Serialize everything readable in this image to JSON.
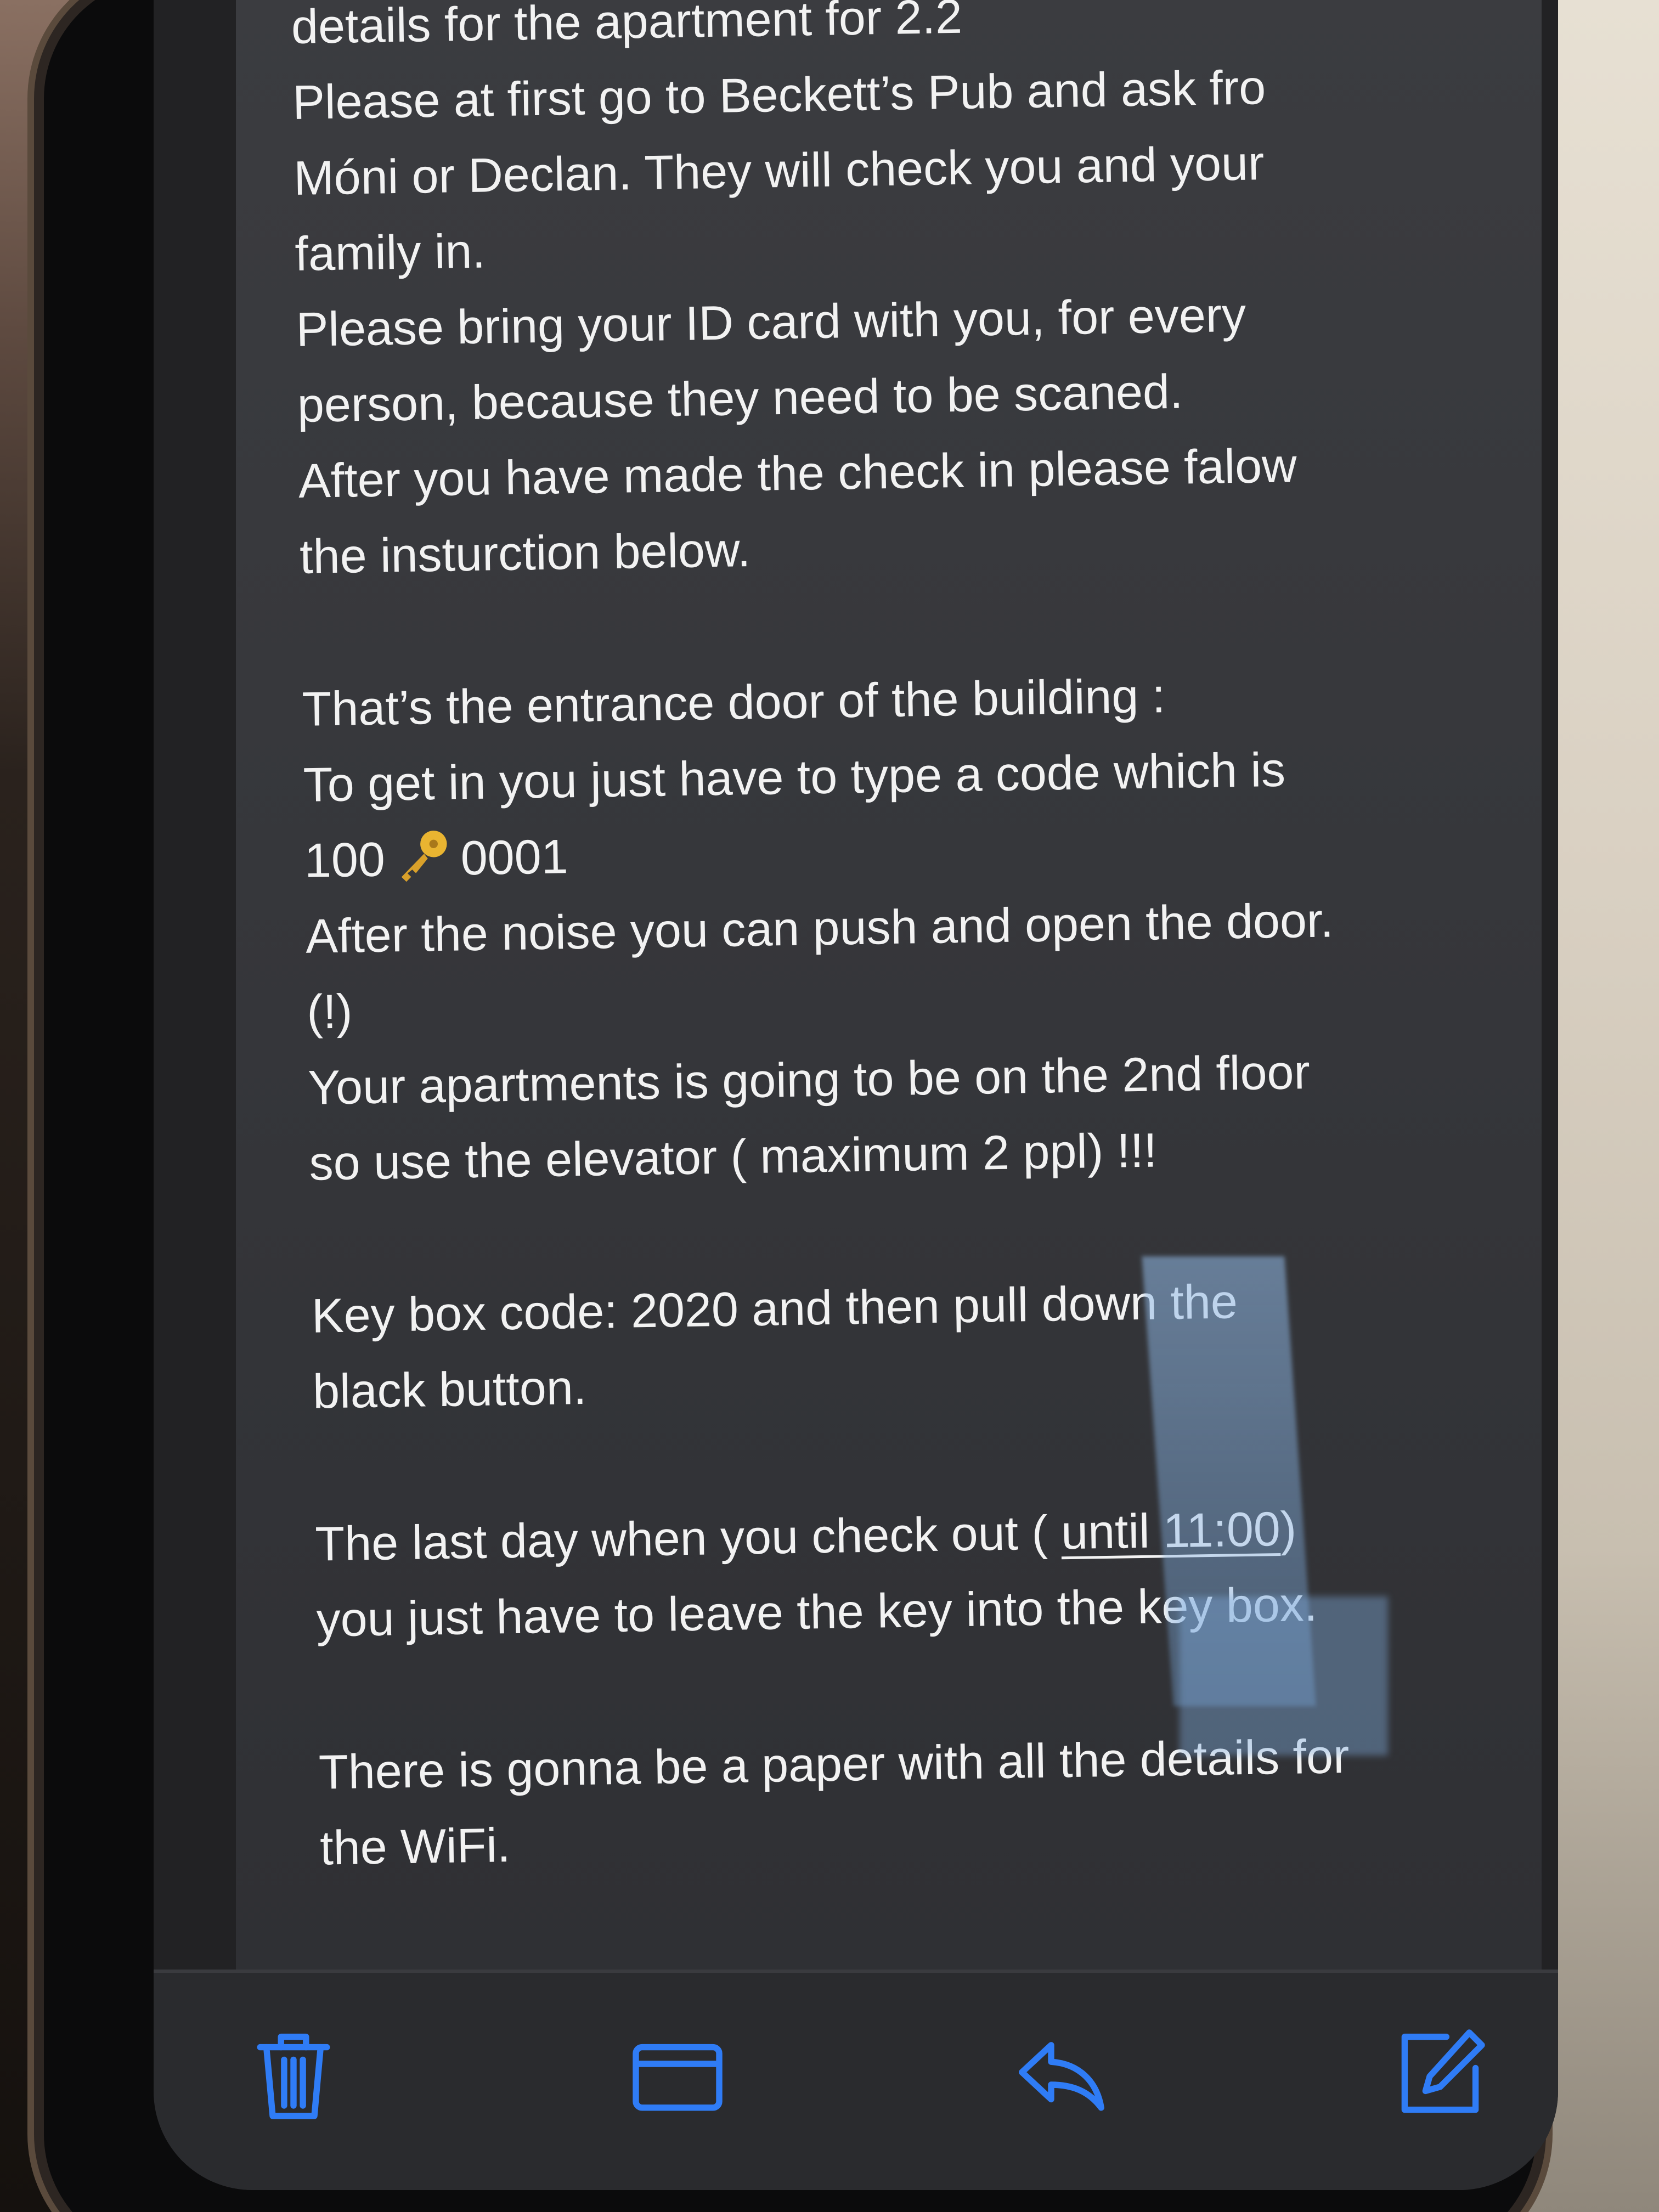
{
  "message": {
    "lines": [
      "details for the apartment for 2.2",
      "Please at first go to Beckett’s Pub and ask fro",
      "Móni or Declan. They will check you and your",
      "family in.",
      "Please bring your ID card with you, for every",
      "person, because they need to be scaned.",
      "After you have made the check in please falow",
      "the insturction below.",
      "That’s the entrance door of the building :",
      "To get in you just have to type a code which is",
      "After the noise you can push and open the door.",
      "(!)",
      "Your apartments is going to be on the 2nd floor",
      "so use the elevator ( maximum 2 ppl) !!!",
      "Key box code: 2020 and then pull down the",
      "black button.",
      "The last day when you check out ( ",
      ")",
      "you just have to leave the key into the key box.",
      "There is gonna be a paper with all the details for",
      "the WiFi."
    ],
    "code_prefix": "100",
    "code_suffix": "0001",
    "key_icon": "key-icon",
    "checkout_time_link": "until 11:00"
  },
  "toolbar": {
    "items": [
      {
        "name": "delete",
        "icon": "trash-icon"
      },
      {
        "name": "move",
        "icon": "folder-icon"
      },
      {
        "name": "reply",
        "icon": "reply-icon"
      },
      {
        "name": "compose",
        "icon": "compose-icon"
      }
    ],
    "accent_color": "#2f7cf6"
  },
  "colors": {
    "text": "#f2f2f2",
    "background": "#38393d",
    "toolbar": "#2a2b2e"
  }
}
